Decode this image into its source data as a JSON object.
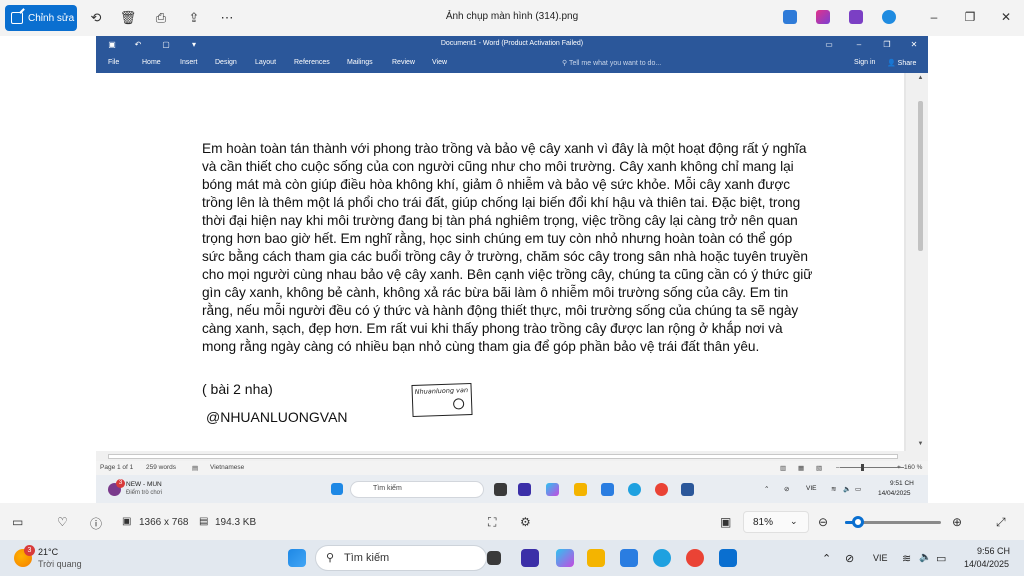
{
  "photos": {
    "edit_label": "Chỉnh sửa",
    "file_title": "Ảnh chụp màn hình (314).png",
    "image_dimensions": "1366 x 768",
    "file_size": "194.3 KB",
    "zoom_value": "81%",
    "accent_color": "#0a6fd0"
  },
  "word": {
    "window_title": "Document1 - Word (Product Activation Failed)",
    "tabs": [
      "File",
      "Home",
      "Insert",
      "Design",
      "Layout",
      "References",
      "Mailings",
      "Review",
      "View"
    ],
    "tell_me": "Tell me what you want to do...",
    "sign_in": "Sign in",
    "share": "Share",
    "ribbon_color": "#2b579a",
    "document": {
      "paragraph": "Em hoàn toàn tán thành với phong trào trồng và bảo vệ cây xanh vì đây là một hoạt  động rất ý nghĩa và cần thiết cho cuộc sống của con người cũng như cho môi trường. Cây xanh không chỉ mang lại bóng mát mà còn giúp điều hòa không khí, giảm ô nhiễm và bảo vệ sức khỏe. Mỗi cây xanh được trồng lên là thêm một lá phổi cho trái đất, giúp chống lại biến đổi khí hậu và thiên tai. Đặc biệt, trong thời đại hiện nay khi môi trường đang bị tàn phá nghiêm trọng, việc trồng cây lại càng trở nên quan trọng hơn bao giờ hết. Em nghĩ rằng, học sinh chúng em tuy còn nhỏ nhưng hoàn toàn có thể góp sức bằng cách tham gia các buổi trồng cây ở trường, chăm sóc cây trong sân nhà hoặc tuyên truyền cho mọi người cùng nhau bảo vệ cây xanh. Bên cạnh việc trồng cây, chúng ta cũng cần có ý thức giữ gìn cây xanh, không bẻ cành, không xả rác bừa bãi làm ô nhiễm môi trường sống của cây. Em tin rằng, nếu mỗi người đều có ý thức và hành động thiết thực, môi trường sống của chúng ta sẽ ngày càng xanh, sạch, đẹp hơn. Em rất vui khi thấy phong trào trồng cây được lan rộng ở khắp nơi và mong rằng ngày càng có nhiều bạn nhỏ cùng tham gia để góp phần bảo vệ trái đất thân yêu.",
      "note": "( bài 2 nha)",
      "signature": "@NHUANLUONGVAN",
      "stamp_text": "Nhuanluong van"
    },
    "status": {
      "page": "Page 1 of 1",
      "words": "259 words",
      "language": "Vietnamese",
      "zoom": "160 %"
    }
  },
  "inner_taskbar": {
    "notif_title": "NEW - MUN",
    "notif_sub": "Điểm trò chơi",
    "notif_badge": "3",
    "search": "Tìm kiếm",
    "lang": "VIE",
    "time": "9:51 CH",
    "date": "14/04/2025"
  },
  "taskbar": {
    "weather_temp": "21°C",
    "weather_desc": "Trời quang",
    "weather_badge": "3",
    "search": "Tìm kiếm",
    "lang": "VIE",
    "time": "9:56 CH",
    "date": "14/04/2025"
  }
}
